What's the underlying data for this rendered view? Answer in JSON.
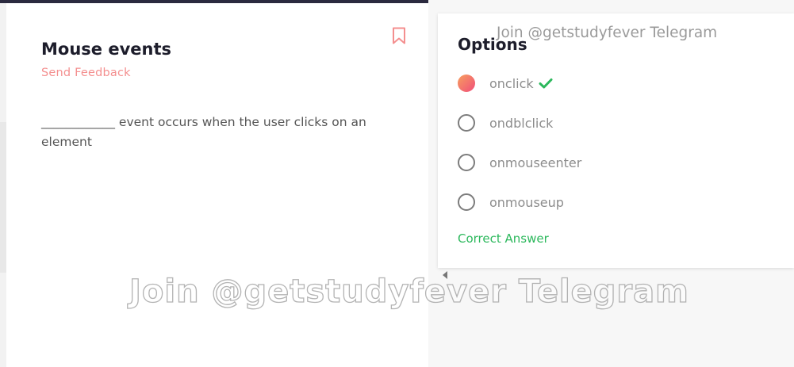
{
  "question": {
    "title": "Mouse events",
    "feedback_label": "Send Feedback",
    "text": "____________ event occurs when the user clicks on an element"
  },
  "options_panel": {
    "title": "Options",
    "options": [
      {
        "label": "onclick",
        "selected": true,
        "correct": true
      },
      {
        "label": "ondblclick",
        "selected": false
      },
      {
        "label": "onmouseenter",
        "selected": false
      },
      {
        "label": "onmouseup",
        "selected": false
      }
    ],
    "correct_label": "Correct Answer"
  },
  "watermark": {
    "top": "Join @getstudyfever Telegram",
    "center": "Join @getstudyfever Telegram"
  },
  "icons": {
    "bookmark": "bookmark-icon",
    "check": "checkmark-icon",
    "selected_radio": "radio-selected-icon"
  },
  "colors": {
    "accent_pink": "#f48f8f",
    "correct_green": "#2cb85c",
    "top_bar": "#2b2a3f",
    "radio_gradient_start": "#f7a05e",
    "radio_gradient_end": "#f04e7a"
  }
}
